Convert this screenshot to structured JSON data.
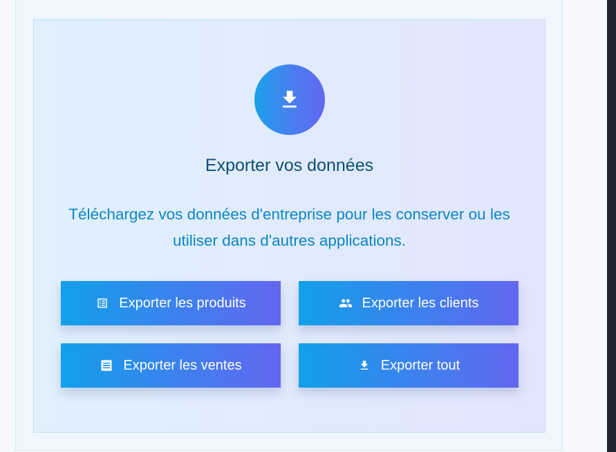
{
  "export_panel": {
    "icon": "download-icon",
    "title": "Exporter vos données",
    "description": "Téléchargez vos données d'entreprise pour les conserver ou les utiliser dans d'autres applications.",
    "accent_colors": [
      "#0ea5e9",
      "#6366f1"
    ],
    "title_color": "#0c4f73",
    "description_color": "#0a86c7",
    "buttons": [
      {
        "label": "Exporter les produits",
        "icon": "list-icon"
      },
      {
        "label": "Exporter les clients",
        "icon": "people-icon"
      },
      {
        "label": "Exporter les ventes",
        "icon": "receipt-icon"
      },
      {
        "label": "Exporter tout",
        "icon": "download-icon"
      }
    ]
  }
}
